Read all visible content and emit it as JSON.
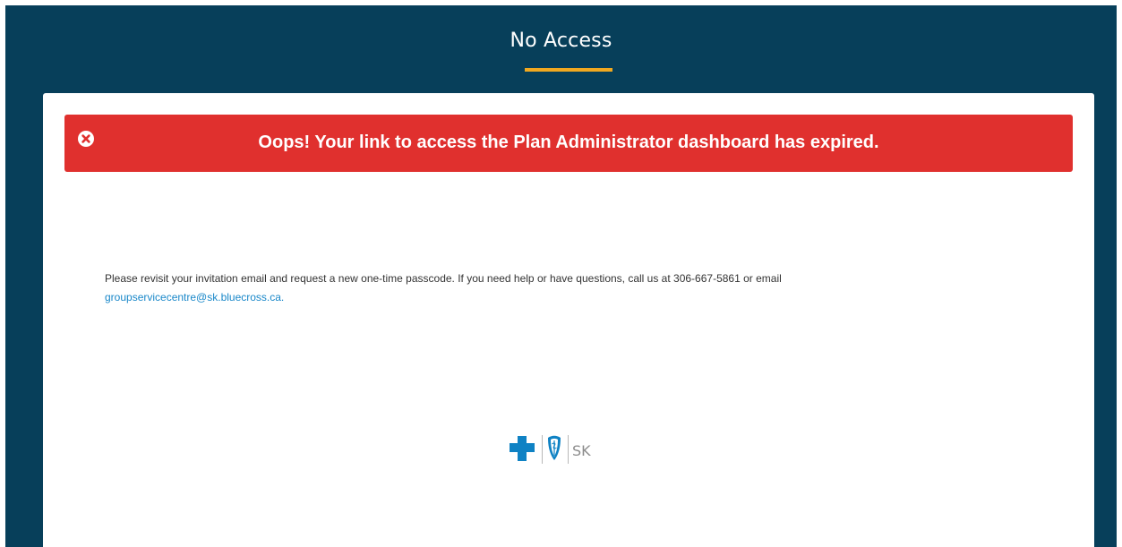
{
  "header": {
    "title": "No Access"
  },
  "alert": {
    "icon": "error-circle-x-icon",
    "message": "Oops! Your link to access the Plan Administrator dashboard has expired."
  },
  "body": {
    "text": "Please revisit your invitation email and request a new one-time passcode. If you need help or have questions, call us at 306-667-5861 or email",
    "email": "groupservicecentre@sk.bluecross.ca."
  },
  "logo": {
    "icons": [
      "blue-cross-icon",
      "blue-shield-icon"
    ],
    "text": "SK"
  },
  "colors": {
    "background": "#073f5a",
    "accent": "#f0a820",
    "alert": "#e0302e",
    "link": "#1a88c9",
    "brand_blue": "#0f82c4"
  }
}
